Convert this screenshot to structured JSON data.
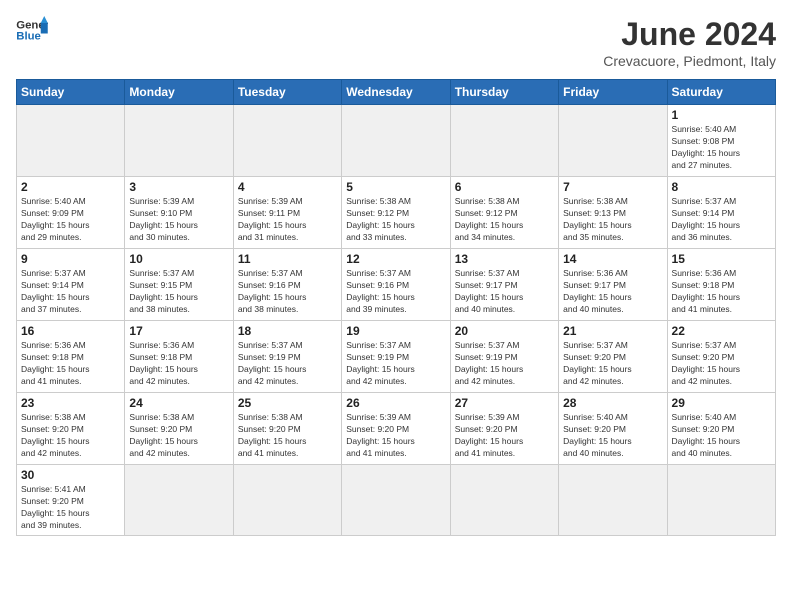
{
  "header": {
    "logo_general": "General",
    "logo_blue": "Blue",
    "title": "June 2024",
    "subtitle": "Crevacuore, Piedmont, Italy"
  },
  "weekdays": [
    "Sunday",
    "Monday",
    "Tuesday",
    "Wednesday",
    "Thursday",
    "Friday",
    "Saturday"
  ],
  "weeks": [
    [
      {
        "day": "",
        "info": ""
      },
      {
        "day": "",
        "info": ""
      },
      {
        "day": "",
        "info": ""
      },
      {
        "day": "",
        "info": ""
      },
      {
        "day": "",
        "info": ""
      },
      {
        "day": "",
        "info": ""
      },
      {
        "day": "1",
        "info": "Sunrise: 5:40 AM\nSunset: 9:08 PM\nDaylight: 15 hours\nand 27 minutes."
      }
    ],
    [
      {
        "day": "2",
        "info": "Sunrise: 5:40 AM\nSunset: 9:09 PM\nDaylight: 15 hours\nand 29 minutes."
      },
      {
        "day": "3",
        "info": "Sunrise: 5:39 AM\nSunset: 9:10 PM\nDaylight: 15 hours\nand 30 minutes."
      },
      {
        "day": "4",
        "info": "Sunrise: 5:39 AM\nSunset: 9:11 PM\nDaylight: 15 hours\nand 31 minutes."
      },
      {
        "day": "5",
        "info": "Sunrise: 5:38 AM\nSunset: 9:12 PM\nDaylight: 15 hours\nand 33 minutes."
      },
      {
        "day": "6",
        "info": "Sunrise: 5:38 AM\nSunset: 9:12 PM\nDaylight: 15 hours\nand 34 minutes."
      },
      {
        "day": "7",
        "info": "Sunrise: 5:38 AM\nSunset: 9:13 PM\nDaylight: 15 hours\nand 35 minutes."
      },
      {
        "day": "8",
        "info": "Sunrise: 5:37 AM\nSunset: 9:14 PM\nDaylight: 15 hours\nand 36 minutes."
      }
    ],
    [
      {
        "day": "9",
        "info": "Sunrise: 5:37 AM\nSunset: 9:14 PM\nDaylight: 15 hours\nand 37 minutes."
      },
      {
        "day": "10",
        "info": "Sunrise: 5:37 AM\nSunset: 9:15 PM\nDaylight: 15 hours\nand 38 minutes."
      },
      {
        "day": "11",
        "info": "Sunrise: 5:37 AM\nSunset: 9:16 PM\nDaylight: 15 hours\nand 38 minutes."
      },
      {
        "day": "12",
        "info": "Sunrise: 5:37 AM\nSunset: 9:16 PM\nDaylight: 15 hours\nand 39 minutes."
      },
      {
        "day": "13",
        "info": "Sunrise: 5:37 AM\nSunset: 9:17 PM\nDaylight: 15 hours\nand 40 minutes."
      },
      {
        "day": "14",
        "info": "Sunrise: 5:36 AM\nSunset: 9:17 PM\nDaylight: 15 hours\nand 40 minutes."
      },
      {
        "day": "15",
        "info": "Sunrise: 5:36 AM\nSunset: 9:18 PM\nDaylight: 15 hours\nand 41 minutes."
      }
    ],
    [
      {
        "day": "16",
        "info": "Sunrise: 5:36 AM\nSunset: 9:18 PM\nDaylight: 15 hours\nand 41 minutes."
      },
      {
        "day": "17",
        "info": "Sunrise: 5:36 AM\nSunset: 9:18 PM\nDaylight: 15 hours\nand 42 minutes."
      },
      {
        "day": "18",
        "info": "Sunrise: 5:37 AM\nSunset: 9:19 PM\nDaylight: 15 hours\nand 42 minutes."
      },
      {
        "day": "19",
        "info": "Sunrise: 5:37 AM\nSunset: 9:19 PM\nDaylight: 15 hours\nand 42 minutes."
      },
      {
        "day": "20",
        "info": "Sunrise: 5:37 AM\nSunset: 9:19 PM\nDaylight: 15 hours\nand 42 minutes."
      },
      {
        "day": "21",
        "info": "Sunrise: 5:37 AM\nSunset: 9:20 PM\nDaylight: 15 hours\nand 42 minutes."
      },
      {
        "day": "22",
        "info": "Sunrise: 5:37 AM\nSunset: 9:20 PM\nDaylight: 15 hours\nand 42 minutes."
      }
    ],
    [
      {
        "day": "23",
        "info": "Sunrise: 5:38 AM\nSunset: 9:20 PM\nDaylight: 15 hours\nand 42 minutes."
      },
      {
        "day": "24",
        "info": "Sunrise: 5:38 AM\nSunset: 9:20 PM\nDaylight: 15 hours\nand 42 minutes."
      },
      {
        "day": "25",
        "info": "Sunrise: 5:38 AM\nSunset: 9:20 PM\nDaylight: 15 hours\nand 41 minutes."
      },
      {
        "day": "26",
        "info": "Sunrise: 5:39 AM\nSunset: 9:20 PM\nDaylight: 15 hours\nand 41 minutes."
      },
      {
        "day": "27",
        "info": "Sunrise: 5:39 AM\nSunset: 9:20 PM\nDaylight: 15 hours\nand 41 minutes."
      },
      {
        "day": "28",
        "info": "Sunrise: 5:40 AM\nSunset: 9:20 PM\nDaylight: 15 hours\nand 40 minutes."
      },
      {
        "day": "29",
        "info": "Sunrise: 5:40 AM\nSunset: 9:20 PM\nDaylight: 15 hours\nand 40 minutes."
      }
    ],
    [
      {
        "day": "30",
        "info": "Sunrise: 5:41 AM\nSunset: 9:20 PM\nDaylight: 15 hours\nand 39 minutes."
      },
      {
        "day": "",
        "info": ""
      },
      {
        "day": "",
        "info": ""
      },
      {
        "day": "",
        "info": ""
      },
      {
        "day": "",
        "info": ""
      },
      {
        "day": "",
        "info": ""
      },
      {
        "day": "",
        "info": ""
      }
    ]
  ]
}
